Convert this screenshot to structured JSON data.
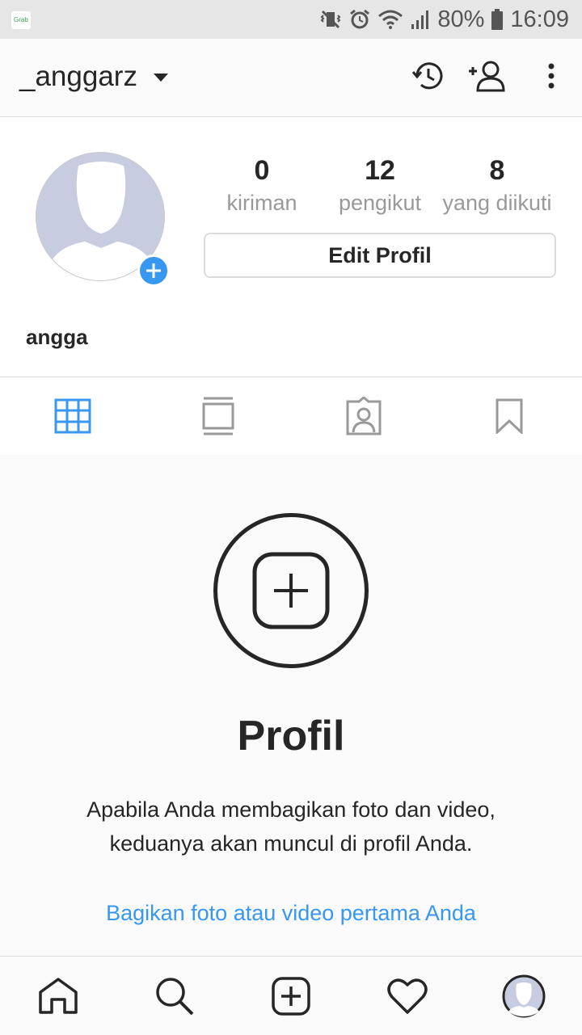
{
  "status_bar": {
    "battery": "80%",
    "time": "16:09",
    "icons": [
      "app-notification-icon",
      "vibrate-icon",
      "alarm-icon",
      "wifi-icon",
      "signal-icon",
      "battery-icon"
    ]
  },
  "app_bar": {
    "username": "_anggarz",
    "icons": [
      "chevron-down-icon",
      "archive-history-icon",
      "add-person-icon",
      "more-vertical-icon"
    ]
  },
  "profile": {
    "full_name": "angga",
    "stats": [
      {
        "value": "0",
        "label": "kiriman"
      },
      {
        "value": "12",
        "label": "pengikut"
      },
      {
        "value": "8",
        "label": "yang diikuti"
      }
    ],
    "edit_button": "Edit Profil"
  },
  "tabs": [
    {
      "icon": "grid-icon",
      "active": true
    },
    {
      "icon": "feed-list-icon",
      "active": false
    },
    {
      "icon": "tagged-icon",
      "active": false
    },
    {
      "icon": "saved-bookmark-icon",
      "active": false
    }
  ],
  "empty_state": {
    "title": "Profil",
    "description_line1": "Apabila Anda membagikan foto dan video,",
    "description_line2": "keduanya akan muncul di profil Anda.",
    "link": "Bagikan foto atau video pertama Anda"
  },
  "bottom_nav": [
    "home-icon",
    "search-icon",
    "new-post-icon",
    "activity-heart-icon",
    "profile-avatar-icon"
  ],
  "colors": {
    "accent_blue": "#3897f0",
    "text_primary": "#262626",
    "text_secondary": "#999999",
    "divider": "#dbdbdb",
    "avatar_placeholder": "#c7cce0"
  }
}
